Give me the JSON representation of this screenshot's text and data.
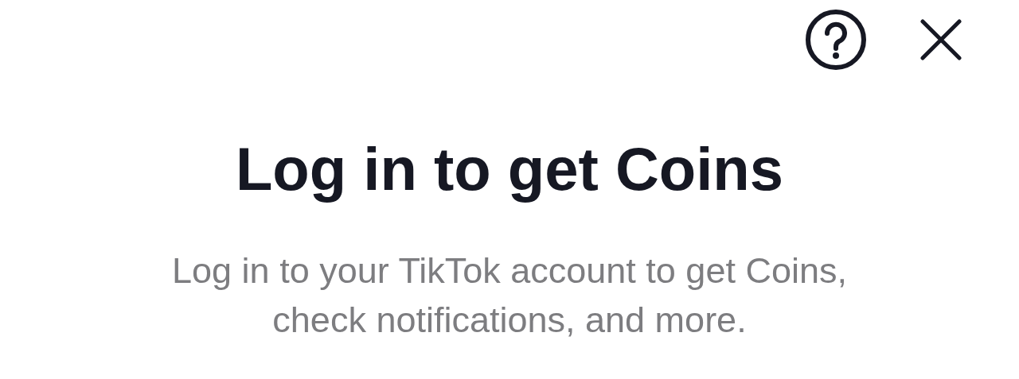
{
  "title": "Log in to get Coins",
  "description": "Log in to your TikTok account to get Coins, check notifications, and more."
}
